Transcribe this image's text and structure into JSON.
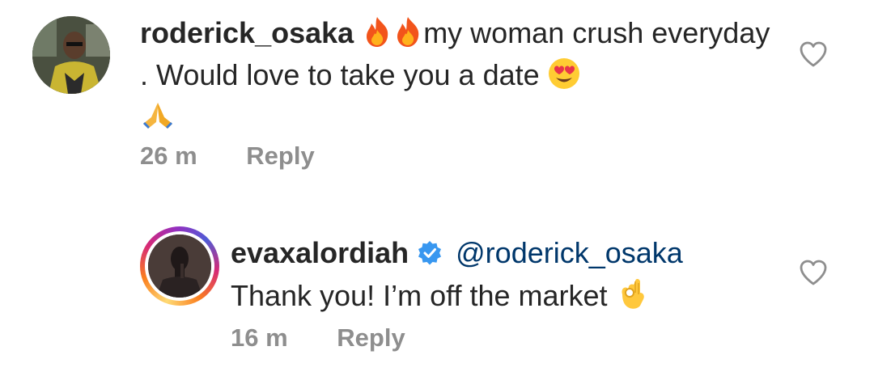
{
  "comments": [
    {
      "username": "roderick_osaka",
      "text_part1": "my woman crush everyday . Would love to take you a date",
      "emojis_before": [
        "fire-emoji",
        "fire-emoji"
      ],
      "emojis_after": [
        "heart-eyes-emoji",
        "folded-hands-emoji"
      ],
      "time": "26 m",
      "reply_label": "Reply"
    },
    {
      "username": "evaxalordiah",
      "verified": true,
      "mention": "@roderick_osaka",
      "text": "Thank you! I’m off the market",
      "emojis_after": [
        "ok-hand-emoji"
      ],
      "time": "16 m",
      "reply_label": "Reply"
    }
  ],
  "colors": {
    "text": "#262626",
    "secondary": "#8e8e8e",
    "mention": "#00376b",
    "verified": "#3897f0"
  }
}
